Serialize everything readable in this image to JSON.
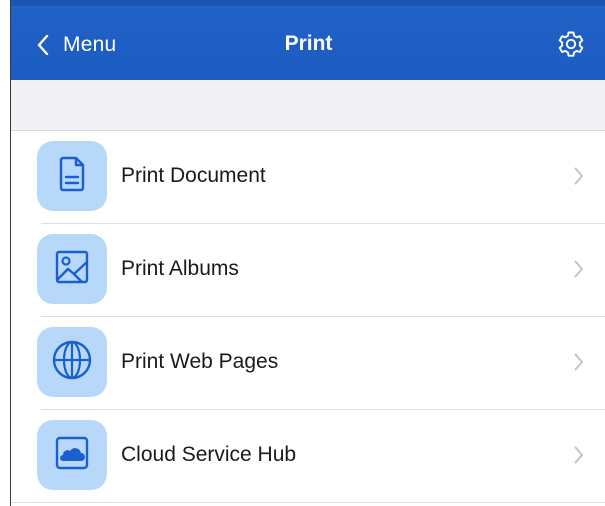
{
  "header": {
    "back_label": "Menu",
    "title": "Print",
    "back_icon": "chevron-left-icon",
    "settings_icon": "gear-icon"
  },
  "menu": {
    "items": [
      {
        "label": "Print Document",
        "icon": "document-icon"
      },
      {
        "label": "Print Albums",
        "icon": "photo-icon"
      },
      {
        "label": "Print Web Pages",
        "icon": "globe-icon"
      },
      {
        "label": "Cloud Service Hub",
        "icon": "cloud-icon"
      }
    ]
  },
  "colors": {
    "nav_background": "#1f60c4",
    "icon_tile": "#b8d8fa",
    "icon_stroke": "#1a5fcf",
    "chevron": "#c4c4c8",
    "spacer": "#f1f1f3"
  }
}
